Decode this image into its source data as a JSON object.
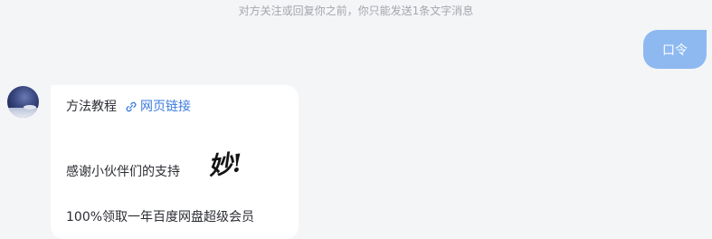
{
  "system_notice": "对方关注或回复你之前，你只能发送1条文字消息",
  "outgoing_message": "口令",
  "incoming_card": {
    "title": "方法教程",
    "link_label": "网页链接",
    "link_icon": "link-icon",
    "thanks_text": "感谢小伙伴们的支持",
    "sticker_text": "妙!",
    "offer_text": "100%领取一年百度网盘超级会员"
  },
  "colors": {
    "page_bg": "#f4f5f7",
    "outgoing_bubble": "#8db9f0",
    "link": "#3d7be0",
    "notice_text": "#a3a6ad"
  }
}
